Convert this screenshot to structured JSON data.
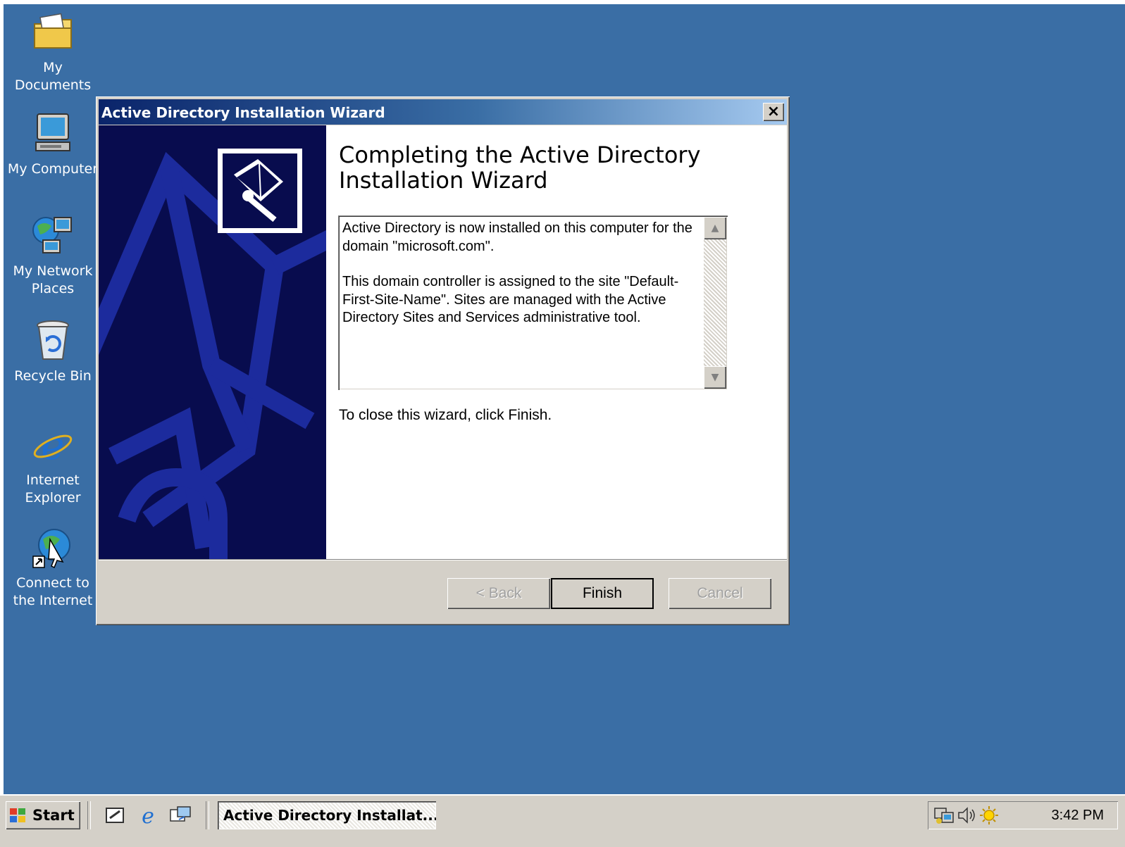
{
  "desktop": {
    "background": "#3a6ea5",
    "icons": [
      {
        "label": "My Documents",
        "icon": "folder-icon"
      },
      {
        "label": "My Computer",
        "icon": "computer-icon"
      },
      {
        "label": "My Network\nPlaces",
        "icon": "network-icon"
      },
      {
        "label": "Recycle Bin",
        "icon": "recycle-bin-icon"
      },
      {
        "label": "Internet\nExplorer",
        "icon": "internet-explorer-icon"
      },
      {
        "label": "Connect to\nthe Internet",
        "icon": "connect-internet-icon"
      }
    ]
  },
  "dialog": {
    "title": "Active Directory Installation Wizard",
    "close_label": "×",
    "heading": "Completing the Active Directory Installation Wizard",
    "info_paragraph_1": "Active Directory is now installed on this computer for the domain \"microsoft.com\".",
    "info_paragraph_2": "This domain controller is assigned to the site \"Default-First-Site-Name\".  Sites are managed with the Active Directory Sites and Services administrative tool.",
    "close_hint": "To close this wizard, click Finish.",
    "buttons": {
      "back": "< Back",
      "finish": "Finish",
      "cancel": "Cancel"
    }
  },
  "taskbar": {
    "start_label": "Start",
    "task_button_label": "Active Directory Installat...",
    "clock": "3:42 PM",
    "quick_launch": [
      "show-desktop-icon",
      "internet-explorer-icon",
      "outlook-express-icon"
    ],
    "tray_icons": [
      "network-status-icon",
      "volume-icon",
      "sun-icon"
    ]
  }
}
